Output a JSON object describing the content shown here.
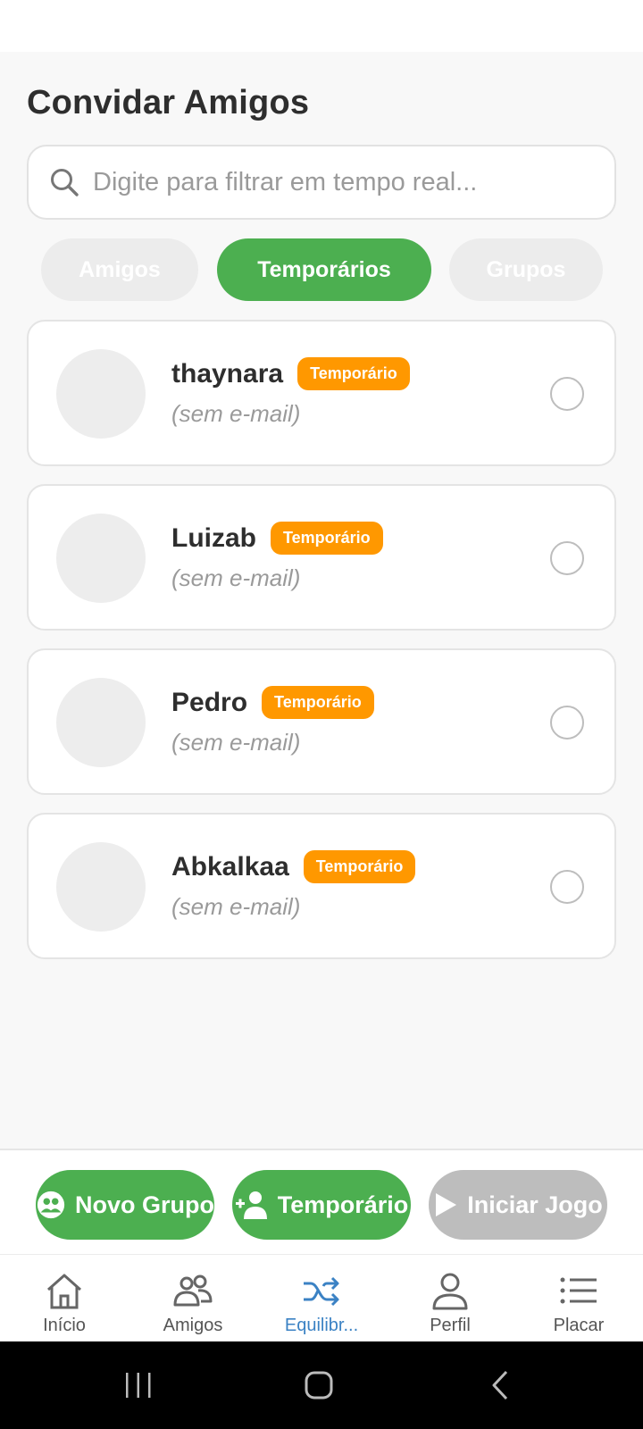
{
  "page": {
    "title": "Convidar Amigos"
  },
  "search": {
    "placeholder": "Digite para filtrar em tempo real..."
  },
  "tabs": [
    {
      "label": "Amigos",
      "active": false
    },
    {
      "label": "Temporários",
      "active": true
    },
    {
      "label": "Grupos",
      "active": false
    }
  ],
  "contacts": [
    {
      "name": "thaynara",
      "badge": "Temporário",
      "email": "(sem e-mail)",
      "selected": false
    },
    {
      "name": "Luizab",
      "badge": "Temporário",
      "email": "(sem e-mail)",
      "selected": false
    },
    {
      "name": "Pedro",
      "badge": "Temporário",
      "email": "(sem e-mail)",
      "selected": false
    },
    {
      "name": "Abkalkaa",
      "badge": "Temporário",
      "email": "(sem e-mail)",
      "selected": false
    }
  ],
  "actions": {
    "new_group": "Novo Grupo",
    "temporary": "Temporário",
    "start_game": "Iniciar Jogo"
  },
  "nav": [
    {
      "label": "Início",
      "icon": "home-icon",
      "active": false
    },
    {
      "label": "Amigos",
      "icon": "people-icon",
      "active": false
    },
    {
      "label": "Equilibr...",
      "icon": "shuffle-icon",
      "active": true
    },
    {
      "label": "Perfil",
      "icon": "person-icon",
      "active": false
    },
    {
      "label": "Placar",
      "icon": "list-icon",
      "active": false
    }
  ],
  "colors": {
    "accent_green": "#4caf50",
    "badge_orange": "#ff9800",
    "disabled_grey": "#bdbdbd",
    "nav_active_blue": "#3b82c4"
  }
}
